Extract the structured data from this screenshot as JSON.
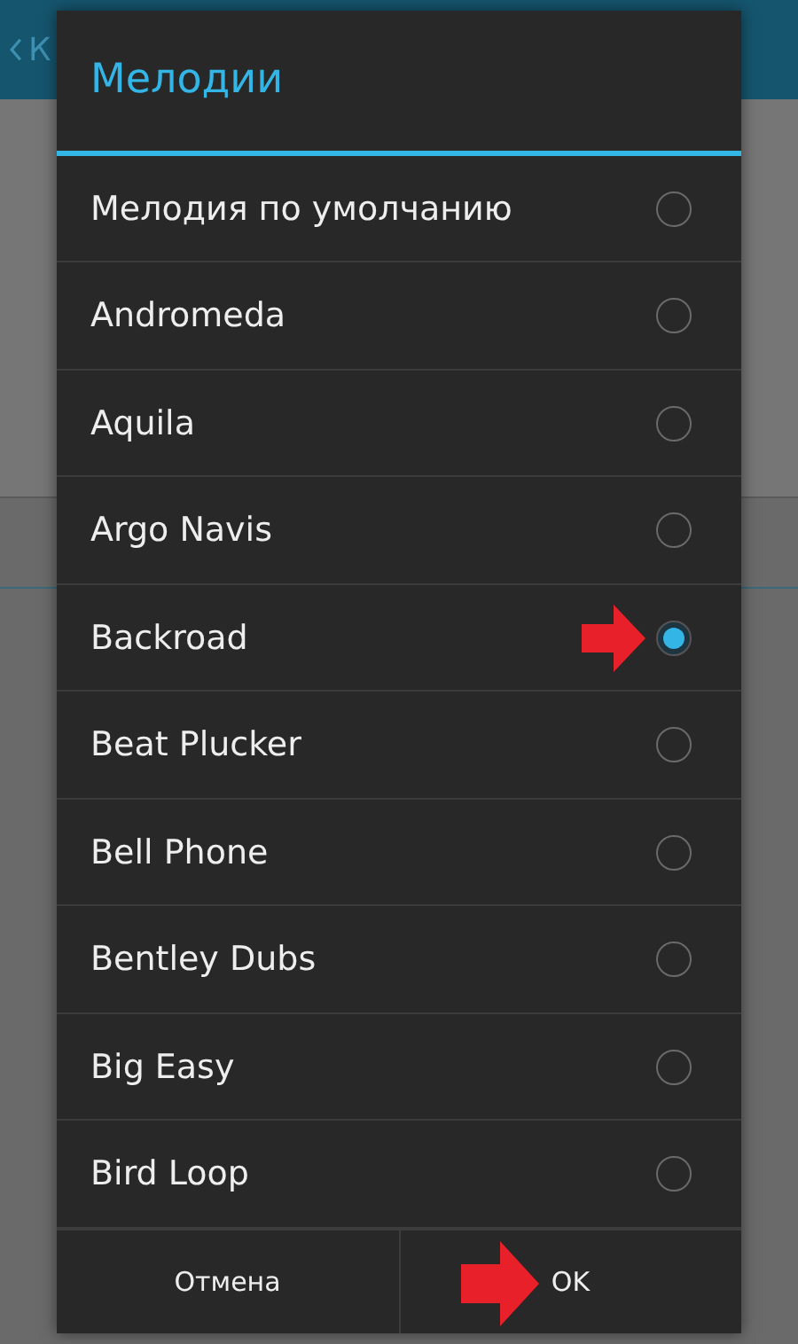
{
  "background": {
    "header_title": "К"
  },
  "dialog": {
    "title": "Мелодии",
    "items": [
      {
        "label": "Мелодия по умолчанию",
        "selected": false,
        "marked": false
      },
      {
        "label": "Andromeda",
        "selected": false,
        "marked": false
      },
      {
        "label": "Aquila",
        "selected": false,
        "marked": false
      },
      {
        "label": "Argo Navis",
        "selected": false,
        "marked": false
      },
      {
        "label": "Backroad",
        "selected": true,
        "marked": true
      },
      {
        "label": "Beat Plucker",
        "selected": false,
        "marked": false
      },
      {
        "label": "Bell Phone",
        "selected": false,
        "marked": false
      },
      {
        "label": "Bentley Dubs",
        "selected": false,
        "marked": false
      },
      {
        "label": "Big Easy",
        "selected": false,
        "marked": false
      },
      {
        "label": "Bird Loop",
        "selected": false,
        "marked": false
      }
    ],
    "buttons": [
      {
        "label": "Отмена",
        "marked": false
      },
      {
        "label": "OK",
        "marked": true
      }
    ]
  }
}
